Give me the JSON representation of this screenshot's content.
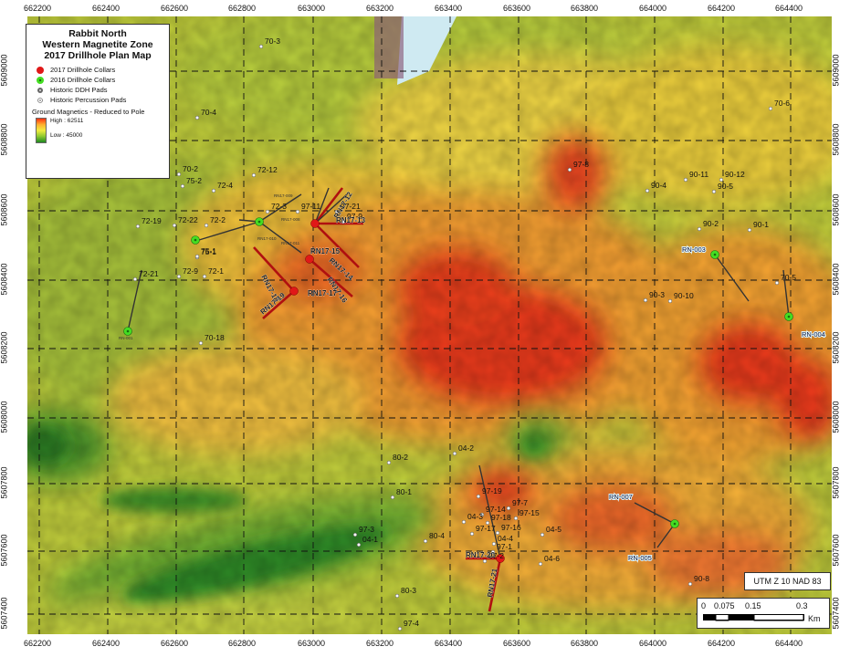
{
  "legend": {
    "title_lines": [
      "Rabbit North",
      "Western Magnetite Zone",
      "2017 Drillhole Plan Map"
    ],
    "items": [
      "2017 Drillhole Collars",
      "2016 Drillhole Collars",
      "Historic DDH Pads",
      "Historic Percussion Pads"
    ],
    "gm_title": "Ground Magnetics - Reduced to Pole",
    "high_label": "High : 62511",
    "low_label": "Low : 45000"
  },
  "utm_label": "UTM Z 10 NAD 83",
  "scale_bar": {
    "labels": [
      "0",
      "0.075",
      "0.15",
      "0.3"
    ],
    "unit": "Km"
  },
  "x_ticks": [
    "662200",
    "662400",
    "662600",
    "662800",
    "663000",
    "663200",
    "663400",
    "663600",
    "663800",
    "664000",
    "664200",
    "664400"
  ],
  "y_ticks": [
    "5609000",
    "5608800",
    "5608600",
    "5608400",
    "5608200",
    "5608000",
    "5607800",
    "5607600",
    "5607400"
  ],
  "colors": {
    "collar_2017": "#e01818",
    "collar_2016": "#44dd22",
    "trace_2017": "#b01010",
    "trace_other": "#333333",
    "grid": "#111111"
  },
  "holes_2017": [
    "RN17-12",
    "RN17-13",
    "RN17-14",
    "RN17-15",
    "RN17-16",
    "RN17-17",
    "RN17-18",
    "RN17-19",
    "RN17-20",
    "RN17-21"
  ],
  "holes_2016": [
    "RN-003",
    "RN-004",
    "RN-005",
    "RN-007"
  ],
  "pad_labels": [
    "70-3",
    "70-4",
    "70-2",
    "75-2",
    "72-4",
    "72-12",
    "72-19",
    "72-22",
    "72-2",
    "75-1",
    "72-3",
    "72-9",
    "72-1",
    "72-21",
    "70-18",
    "97-11",
    "97-21",
    "97-9",
    "75-1",
    "97-8",
    "90-4",
    "90-11",
    "90-12",
    "90-5",
    "90-2",
    "90-1",
    "70-6",
    "70-5",
    "90-3",
    "90-10",
    "80-2",
    "80-1",
    "04-2",
    "97-19",
    "97-7",
    "97-14",
    "97-15",
    "04-3",
    "97-18",
    "97-17",
    "97-16",
    "04-4",
    "97-1",
    "04-5",
    "97-2",
    "04-6",
    "97-3",
    "04-1",
    "80-4",
    "80-3",
    "97-4",
    "90-8"
  ],
  "small_labels": [
    "RN17-009",
    "RN17-008",
    "RN17-011",
    "RN17-010",
    "RN-001"
  ]
}
